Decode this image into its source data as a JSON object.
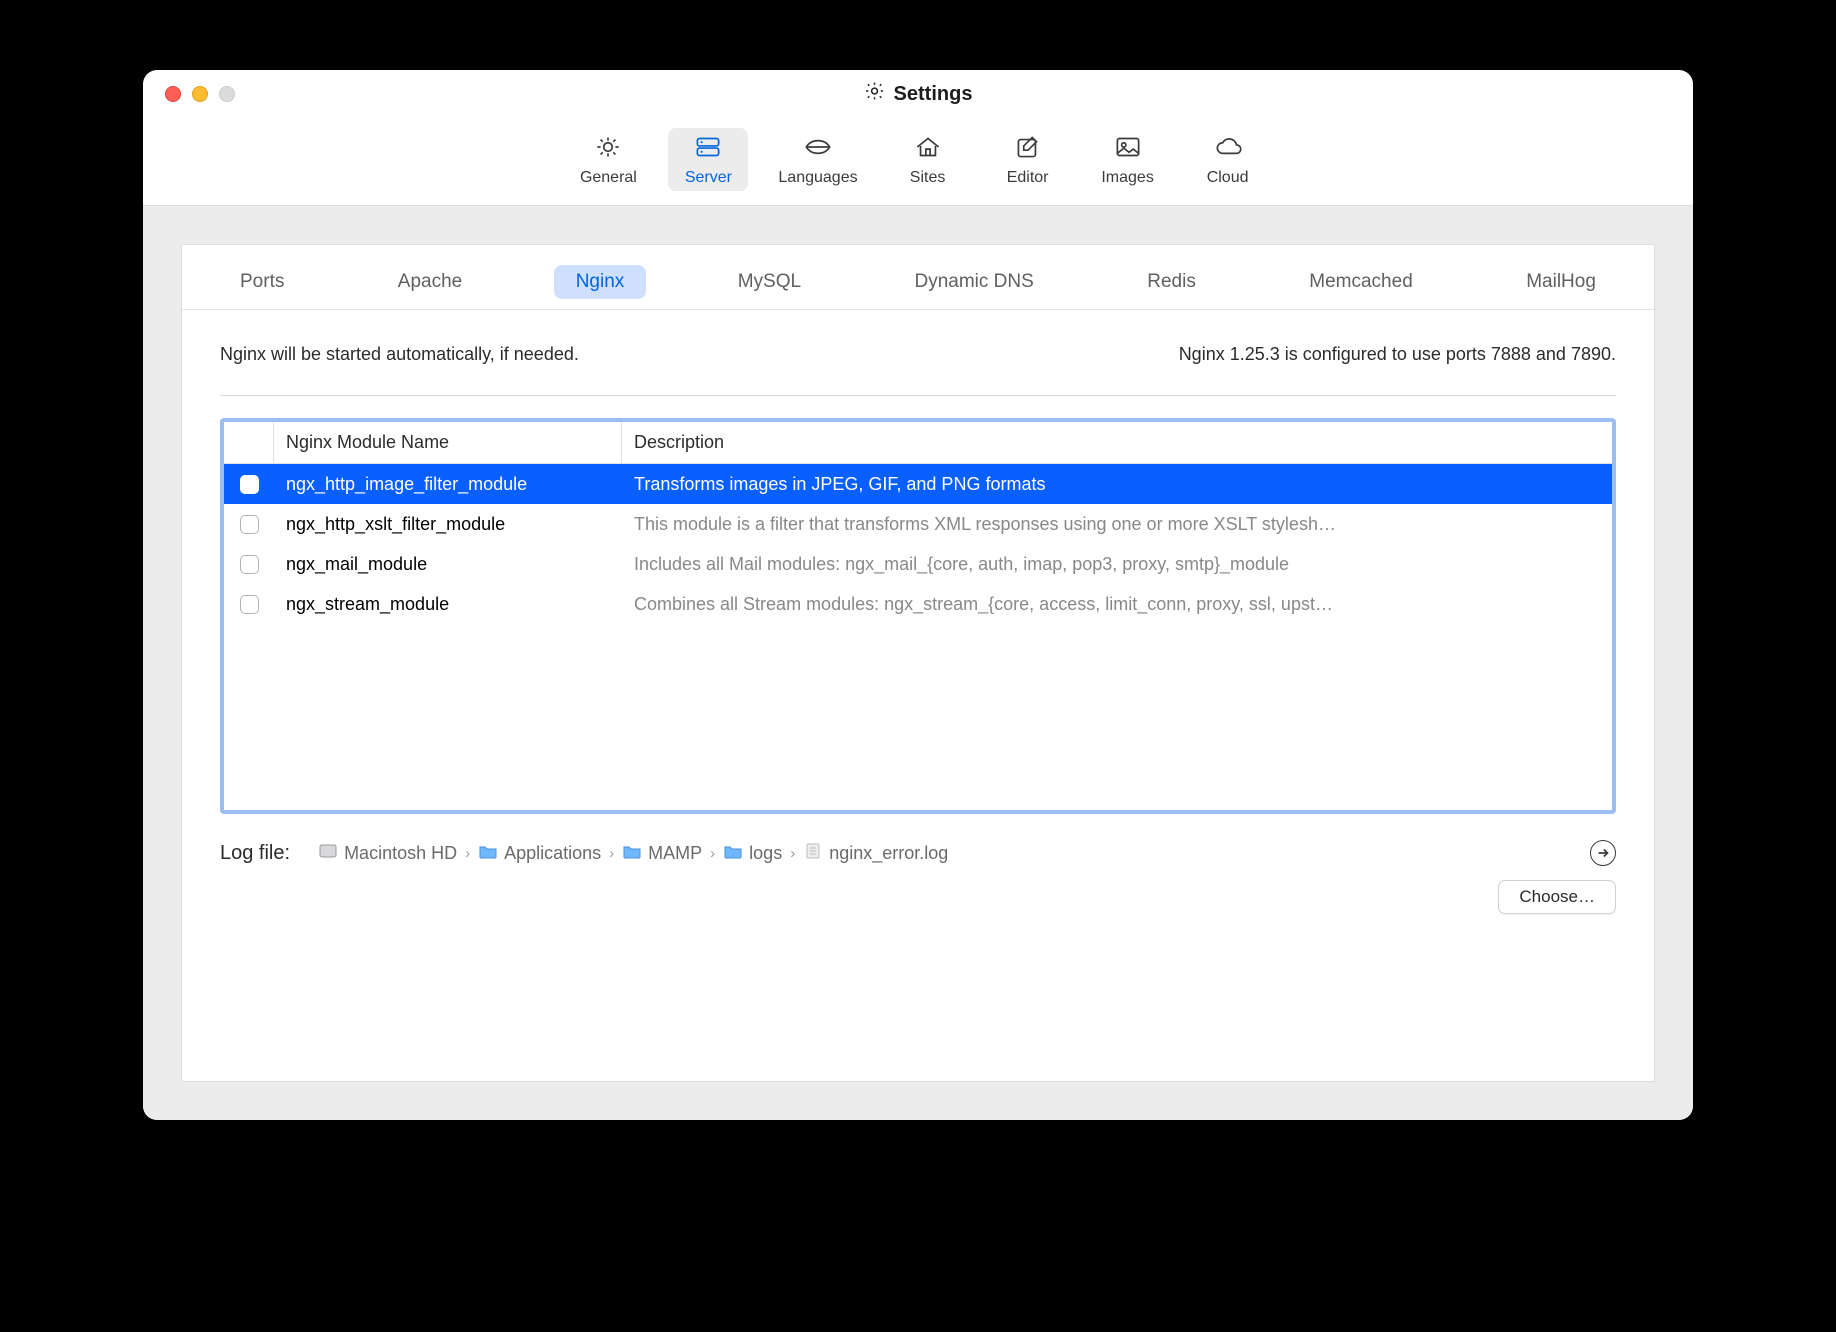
{
  "window": {
    "title": "Settings"
  },
  "toolbar": [
    {
      "id": "general",
      "label": "General"
    },
    {
      "id": "server",
      "label": "Server"
    },
    {
      "id": "languages",
      "label": "Languages"
    },
    {
      "id": "sites",
      "label": "Sites"
    },
    {
      "id": "editor",
      "label": "Editor"
    },
    {
      "id": "images",
      "label": "Images"
    },
    {
      "id": "cloud",
      "label": "Cloud"
    }
  ],
  "toolbar_active": "server",
  "subtabs": [
    "Ports",
    "Apache",
    "Nginx",
    "MySQL",
    "Dynamic DNS",
    "Redis",
    "Memcached",
    "MailHog"
  ],
  "subtab_active": "Nginx",
  "status": {
    "left": "Nginx will be started automatically, if needed.",
    "right": "Nginx 1.25.3 is configured to use ports 7888 and 7890."
  },
  "table": {
    "columns": {
      "name": "Nginx Module Name",
      "desc": "Description"
    },
    "rows": [
      {
        "checked": false,
        "selected": true,
        "name": "ngx_http_image_filter_module",
        "desc": "Transforms images in JPEG, GIF, and PNG formats"
      },
      {
        "checked": false,
        "selected": false,
        "name": "ngx_http_xslt_filter_module",
        "desc": "This module is a filter that transforms XML responses using one or more XSLT stylesh…"
      },
      {
        "checked": false,
        "selected": false,
        "name": "ngx_mail_module",
        "desc": "Includes all Mail modules: ngx_mail_{core, auth, imap, pop3, proxy, smtp}_module"
      },
      {
        "checked": false,
        "selected": false,
        "name": "ngx_stream_module",
        "desc": "Combines all Stream modules: ngx_stream_{core, access, limit_conn, proxy, ssl, upst…"
      }
    ]
  },
  "logfile": {
    "label": "Log file:",
    "crumbs": [
      {
        "icon": "disk",
        "text": "Macintosh HD"
      },
      {
        "icon": "folder",
        "text": "Applications"
      },
      {
        "icon": "folder",
        "text": "MAMP"
      },
      {
        "icon": "folder",
        "text": "logs"
      },
      {
        "icon": "file",
        "text": "nginx_error.log"
      }
    ]
  },
  "choose_label": "Choose…"
}
